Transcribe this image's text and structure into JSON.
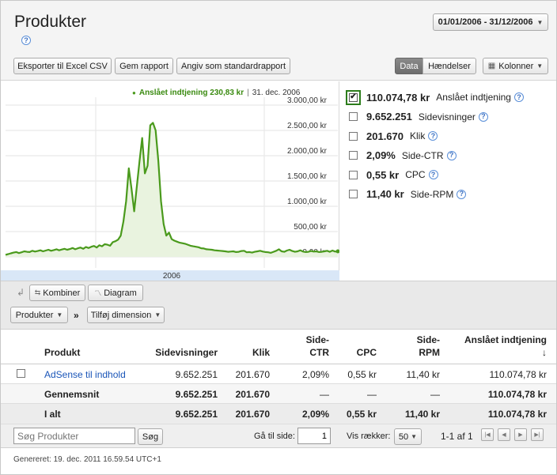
{
  "page": {
    "title": "Produkter",
    "date_range": "01/01/2006 - 31/12/2006"
  },
  "toolbar_top": {
    "export": "Eksporter til Excel CSV",
    "save": "Gem rapport",
    "default": "Angiv som standardrapport",
    "view_data": "Data",
    "view_events": "Hændelser",
    "columns": "Kolonner"
  },
  "chart_legend": {
    "series_label": "Anslået indtjening 230,83 kr",
    "date": "31. dec. 2006"
  },
  "chart_data": {
    "type": "line",
    "x_tick_labels": [
      "2006"
    ],
    "y_tick_labels": [
      "3.000,00 kr",
      "2.500,00 kr",
      "2.000,00 kr",
      "1.500,00 kr",
      "1.000,00 kr",
      "500,00 kr",
      "0,00 kr"
    ],
    "ylim": [
      0,
      3000
    ],
    "series": [
      {
        "name": "Anslået indtjening",
        "color": "#4a9a1c",
        "values": [
          40,
          55,
          70,
          85,
          95,
          75,
          90,
          110,
          100,
          95,
          120,
          105,
          115,
          130,
          110,
          125,
          140,
          120,
          135,
          150,
          130,
          145,
          160,
          140,
          155,
          175,
          150,
          170,
          185,
          160,
          195,
          175,
          200,
          215,
          185,
          230,
          210,
          250,
          240,
          220,
          290,
          310,
          340,
          420,
          700,
          1100,
          1750,
          1350,
          900,
          1400,
          1900,
          2350,
          1650,
          1800,
          2600,
          2650,
          2500,
          1900,
          1100,
          650,
          420,
          480,
          350,
          320,
          300,
          280,
          270,
          260,
          240,
          220,
          210,
          200,
          190,
          170,
          165,
          150,
          145,
          140,
          130,
          125,
          120,
          115,
          110,
          100,
          105,
          110,
          95,
          100,
          115,
          120,
          90,
          95,
          85,
          100,
          110,
          120,
          105,
          95,
          90,
          80,
          100,
          120,
          150,
          110,
          100,
          125,
          140,
          115,
          100,
          110,
          130,
          105,
          95,
          100,
          115,
          105,
          110,
          95,
          100,
          110,
          120,
          100,
          125,
          105,
          110
        ]
      }
    ]
  },
  "metrics": [
    {
      "value": "110.074,78 kr",
      "label": "Anslået indtjening",
      "checked": true
    },
    {
      "value": "9.652.251",
      "label": "Sidevisninger",
      "checked": false
    },
    {
      "value": "201.670",
      "label": "Klik",
      "checked": false
    },
    {
      "value": "2,09%",
      "label": "Side-CTR",
      "checked": false
    },
    {
      "value": "0,55 kr",
      "label": "CPC",
      "checked": false
    },
    {
      "value": "11,40 kr",
      "label": "Side-RPM",
      "checked": false
    }
  ],
  "toolbar_mid": {
    "combine": "Kombiner",
    "diagram": "Diagram",
    "dimension": "Produkter",
    "sep": "»",
    "add_dimension": "Tilføj dimension"
  },
  "table": {
    "headers": {
      "product": "Produkt",
      "pageviews": "Sidevisninger",
      "clicks": "Klik",
      "ctr1": "Side-",
      "ctr2": "CTR",
      "cpc": "CPC",
      "rpm1": "Side-",
      "rpm2": "RPM",
      "earnings": "Anslået indtjening",
      "sort": "↓"
    },
    "row": {
      "product": "AdSense til indhold",
      "pageviews": "9.652.251",
      "clicks": "201.670",
      "ctr": "2,09%",
      "cpc": "0,55 kr",
      "rpm": "11,40 kr",
      "earnings": "110.074,78 kr"
    },
    "avg": {
      "product": "Gennemsnit",
      "pageviews": "9.652.251",
      "clicks": "201.670",
      "ctr": "—",
      "cpc": "—",
      "rpm": "—",
      "earnings": "110.074,78 kr"
    },
    "total": {
      "product": "I alt",
      "pageviews": "9.652.251",
      "clicks": "201.670",
      "ctr": "2,09%",
      "cpc": "0,55 kr",
      "rpm": "11,40 kr",
      "earnings": "110.074,78 kr"
    }
  },
  "bottom": {
    "search_placeholder": "Søg Produkter",
    "search_btn": "Søg",
    "goto_label": "Gå til side:",
    "goto_value": "1",
    "rows_label": "Vis rækker:",
    "rows_value": "50",
    "pagination": "1-1 af 1"
  },
  "generated": "Genereret: 19. dec. 2011 16.59.54 UTC+1"
}
